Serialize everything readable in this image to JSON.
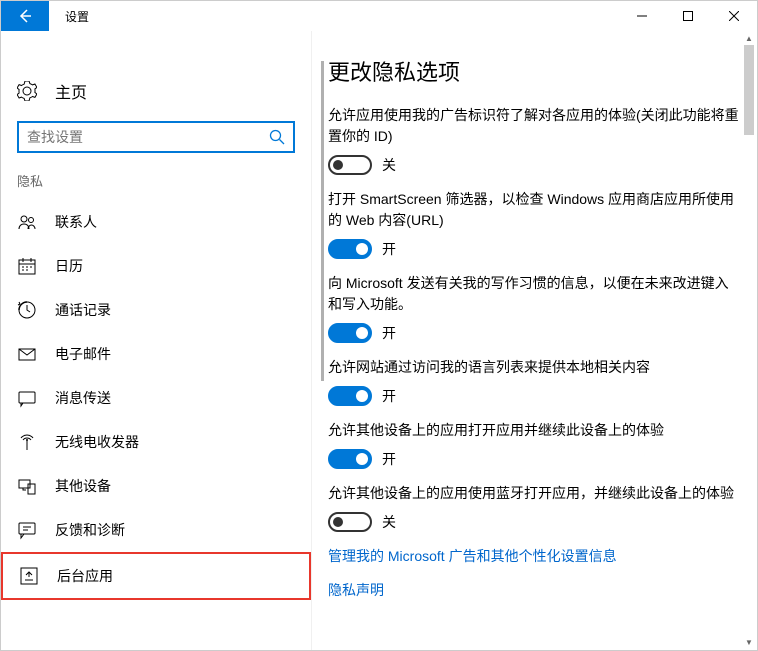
{
  "window": {
    "title": "设置"
  },
  "sidebar": {
    "home": "主页",
    "search_placeholder": "查找设置",
    "category": "隐私",
    "items": [
      {
        "label": "联系人",
        "icon": "contacts"
      },
      {
        "label": "日历",
        "icon": "calendar"
      },
      {
        "label": "通话记录",
        "icon": "call-history"
      },
      {
        "label": "电子邮件",
        "icon": "email"
      },
      {
        "label": "消息传送",
        "icon": "messaging"
      },
      {
        "label": "无线电收发器",
        "icon": "radios"
      },
      {
        "label": "其他设备",
        "icon": "other-devices"
      },
      {
        "label": "反馈和诊断",
        "icon": "feedback"
      },
      {
        "label": "后台应用",
        "icon": "background-apps"
      }
    ]
  },
  "main": {
    "title": "更改隐私选项",
    "settings": [
      {
        "desc": "允许应用使用我的广告标识符了解对各应用的体验(关闭此功能将重置你的 ID)",
        "state": "off",
        "label": "关"
      },
      {
        "desc": "打开 SmartScreen 筛选器，以检查 Windows 应用商店应用所使用的 Web 内容(URL)",
        "state": "on",
        "label": "开"
      },
      {
        "desc": "向 Microsoft 发送有关我的写作习惯的信息，以便在未来改进键入和写入功能。",
        "state": "on",
        "label": "开"
      },
      {
        "desc": "允许网站通过访问我的语言列表来提供本地相关内容",
        "state": "on",
        "label": "开"
      },
      {
        "desc": "允许其他设备上的应用打开应用并继续此设备上的体验",
        "state": "on",
        "label": "开"
      },
      {
        "desc": "允许其他设备上的应用使用蓝牙打开应用，并继续此设备上的体验",
        "state": "off",
        "label": "关"
      }
    ],
    "link1": "管理我的 Microsoft 广告和其他个性化设置信息",
    "link2": "隐私声明"
  }
}
